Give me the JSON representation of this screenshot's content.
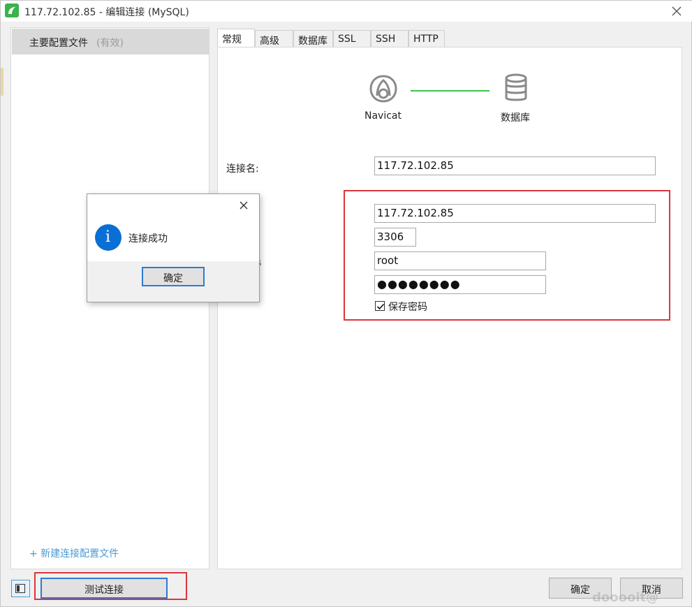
{
  "window": {
    "title": "117.72.102.85 - 编辑连接 (MySQL)",
    "brand_color": "#3bb34a"
  },
  "sidebar": {
    "profile_label": "主要配置文件",
    "profile_status": "(有效)",
    "new_profile_link": "+ 新建连接配置文件"
  },
  "tabs": [
    {
      "label": "常规",
      "active": true
    },
    {
      "label": "高级",
      "active": false
    },
    {
      "label": "数据库",
      "active": false
    },
    {
      "label": "SSL",
      "active": false
    },
    {
      "label": "SSH",
      "active": false
    },
    {
      "label": "HTTP",
      "active": false
    }
  ],
  "diagram": {
    "left_label": "Navicat",
    "right_label": "数据库",
    "line_color": "#3ec24f"
  },
  "form": {
    "connection_name_label": "连接名:",
    "connection_name": "117.72.102.85",
    "host": "117.72.102.85",
    "port": "3306",
    "user": "root",
    "password_mask": "●●●●●●●●",
    "save_password_label": "保存密码",
    "save_password_checked": true,
    "obscured_label_fragment": "s"
  },
  "dialog": {
    "message": "连接成功",
    "ok_label": "确定",
    "icon": "info-icon"
  },
  "footer": {
    "test_connection_label": "测试连接",
    "ok_label": "确定",
    "cancel_label": "取消"
  },
  "highlight_color": "#d9363e",
  "watermark": "dooooit@"
}
